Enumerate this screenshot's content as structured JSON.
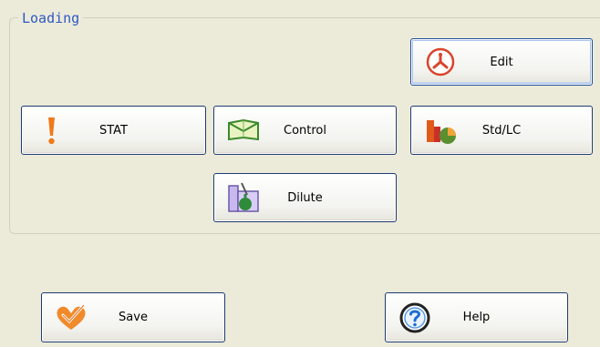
{
  "panel": {
    "title": "Loading"
  },
  "buttons": {
    "edit": {
      "label": "Edit",
      "icon": "edit-icon"
    },
    "stat": {
      "label": "STAT",
      "icon": "exclamation-icon"
    },
    "control": {
      "label": "Control",
      "icon": "envelope-icon"
    },
    "stdlc": {
      "label": "Std/LC",
      "icon": "bar-pie-chart-icon"
    },
    "dilute": {
      "label": "Dilute",
      "icon": "beaker-icon"
    },
    "save": {
      "label": "Save",
      "icon": "save-heart-icon"
    },
    "help": {
      "label": "Help",
      "icon": "help-icon"
    }
  },
  "colors": {
    "background": "#ecead9",
    "title": "#2d59c4",
    "button_border": "#1d3b73"
  }
}
